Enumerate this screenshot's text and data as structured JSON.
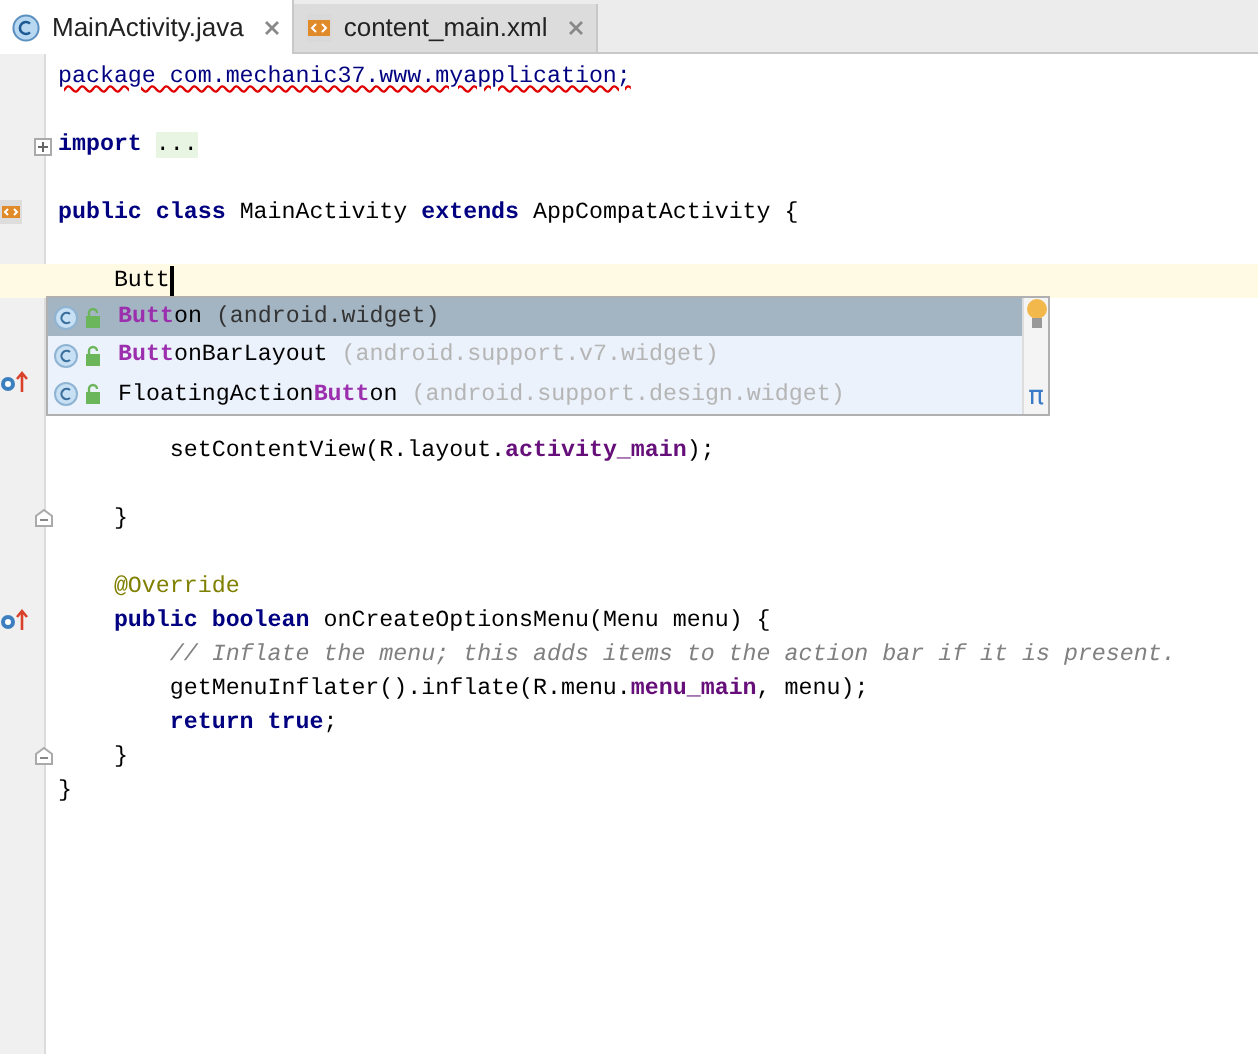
{
  "tabs": [
    {
      "label": "MainActivity.java",
      "kind": "java",
      "selected": true
    },
    {
      "label": "content_main.xml",
      "kind": "xml",
      "selected": false
    }
  ],
  "lines": [
    {
      "kind": "code",
      "tokens": [
        {
          "kind": "error",
          "text": "package com.mechanic37.www.myapplication;"
        }
      ]
    },
    {
      "kind": "blank"
    },
    {
      "kind": "code",
      "gutter": {
        "kind": "expand"
      },
      "tokens": [
        {
          "kind": "keyword",
          "text": "import "
        },
        {
          "kind": "folded",
          "text": "..."
        }
      ]
    },
    {
      "kind": "blank"
    },
    {
      "kind": "code",
      "gutter": {
        "kind": "xml"
      },
      "tokens": [
        {
          "kind": "keyword",
          "text": "public class "
        },
        {
          "kind": "plain",
          "text": "MainActivity "
        },
        {
          "kind": "keyword",
          "text": "extends "
        },
        {
          "kind": "plain",
          "text": "AppCompatActivity {"
        }
      ]
    },
    {
      "kind": "blank"
    },
    {
      "kind": "code",
      "current": true,
      "tokens": [
        {
          "kind": "plain",
          "text": "    Butt"
        }
      ]
    },
    {
      "kind": "blank"
    },
    {
      "kind": "blank"
    },
    {
      "kind": "blank",
      "gutter": {
        "kind": "override"
      }
    },
    {
      "kind": "blank"
    },
    {
      "kind": "code",
      "tokens": [
        {
          "kind": "plain",
          "text": "        setContentView(R.layout."
        },
        {
          "kind": "field",
          "text": "activity_main"
        },
        {
          "kind": "plain",
          "text": ");"
        }
      ]
    },
    {
      "kind": "blank"
    },
    {
      "kind": "code",
      "gutter": {
        "kind": "fold"
      },
      "tokens": [
        {
          "kind": "plain",
          "text": "    }"
        }
      ]
    },
    {
      "kind": "blank"
    },
    {
      "kind": "code",
      "tokens": [
        {
          "kind": "annotation",
          "text": "    @Override"
        }
      ]
    },
    {
      "kind": "code",
      "gutter": {
        "kind": "override"
      },
      "tokens": [
        {
          "kind": "keyword",
          "text": "    public boolean "
        },
        {
          "kind": "plain",
          "text": "onCreateOptionsMenu(Menu menu) {"
        }
      ]
    },
    {
      "kind": "code",
      "tokens": [
        {
          "kind": "comment",
          "text": "        // Inflate the menu; this adds items to the action bar if it is present."
        }
      ]
    },
    {
      "kind": "code",
      "tokens": [
        {
          "kind": "plain",
          "text": "        getMenuInflater().inflate(R.menu."
        },
        {
          "kind": "field",
          "text": "menu_main"
        },
        {
          "kind": "plain",
          "text": ", menu);"
        }
      ]
    },
    {
      "kind": "code",
      "tokens": [
        {
          "kind": "keyword",
          "text": "        return true"
        },
        {
          "kind": "plain",
          "text": ";"
        }
      ]
    },
    {
      "kind": "code",
      "gutter": {
        "kind": "fold"
      },
      "tokens": [
        {
          "kind": "plain",
          "text": "    }"
        }
      ]
    },
    {
      "kind": "code",
      "tokens": [
        {
          "kind": "plain",
          "text": "}"
        }
      ]
    }
  ],
  "completion": {
    "items": [
      {
        "match": "Butt",
        "after": "on",
        "package": "(android.widget)",
        "selected": true
      },
      {
        "match": "Butt",
        "after": "onBarLayout",
        "package": "(android.support.v7.widget)",
        "selected": false
      },
      {
        "before": "FloatingAction",
        "match": "Butt",
        "after": "on",
        "package": "(android.support.design.widget)",
        "selected": false
      }
    ],
    "footer": "π"
  }
}
